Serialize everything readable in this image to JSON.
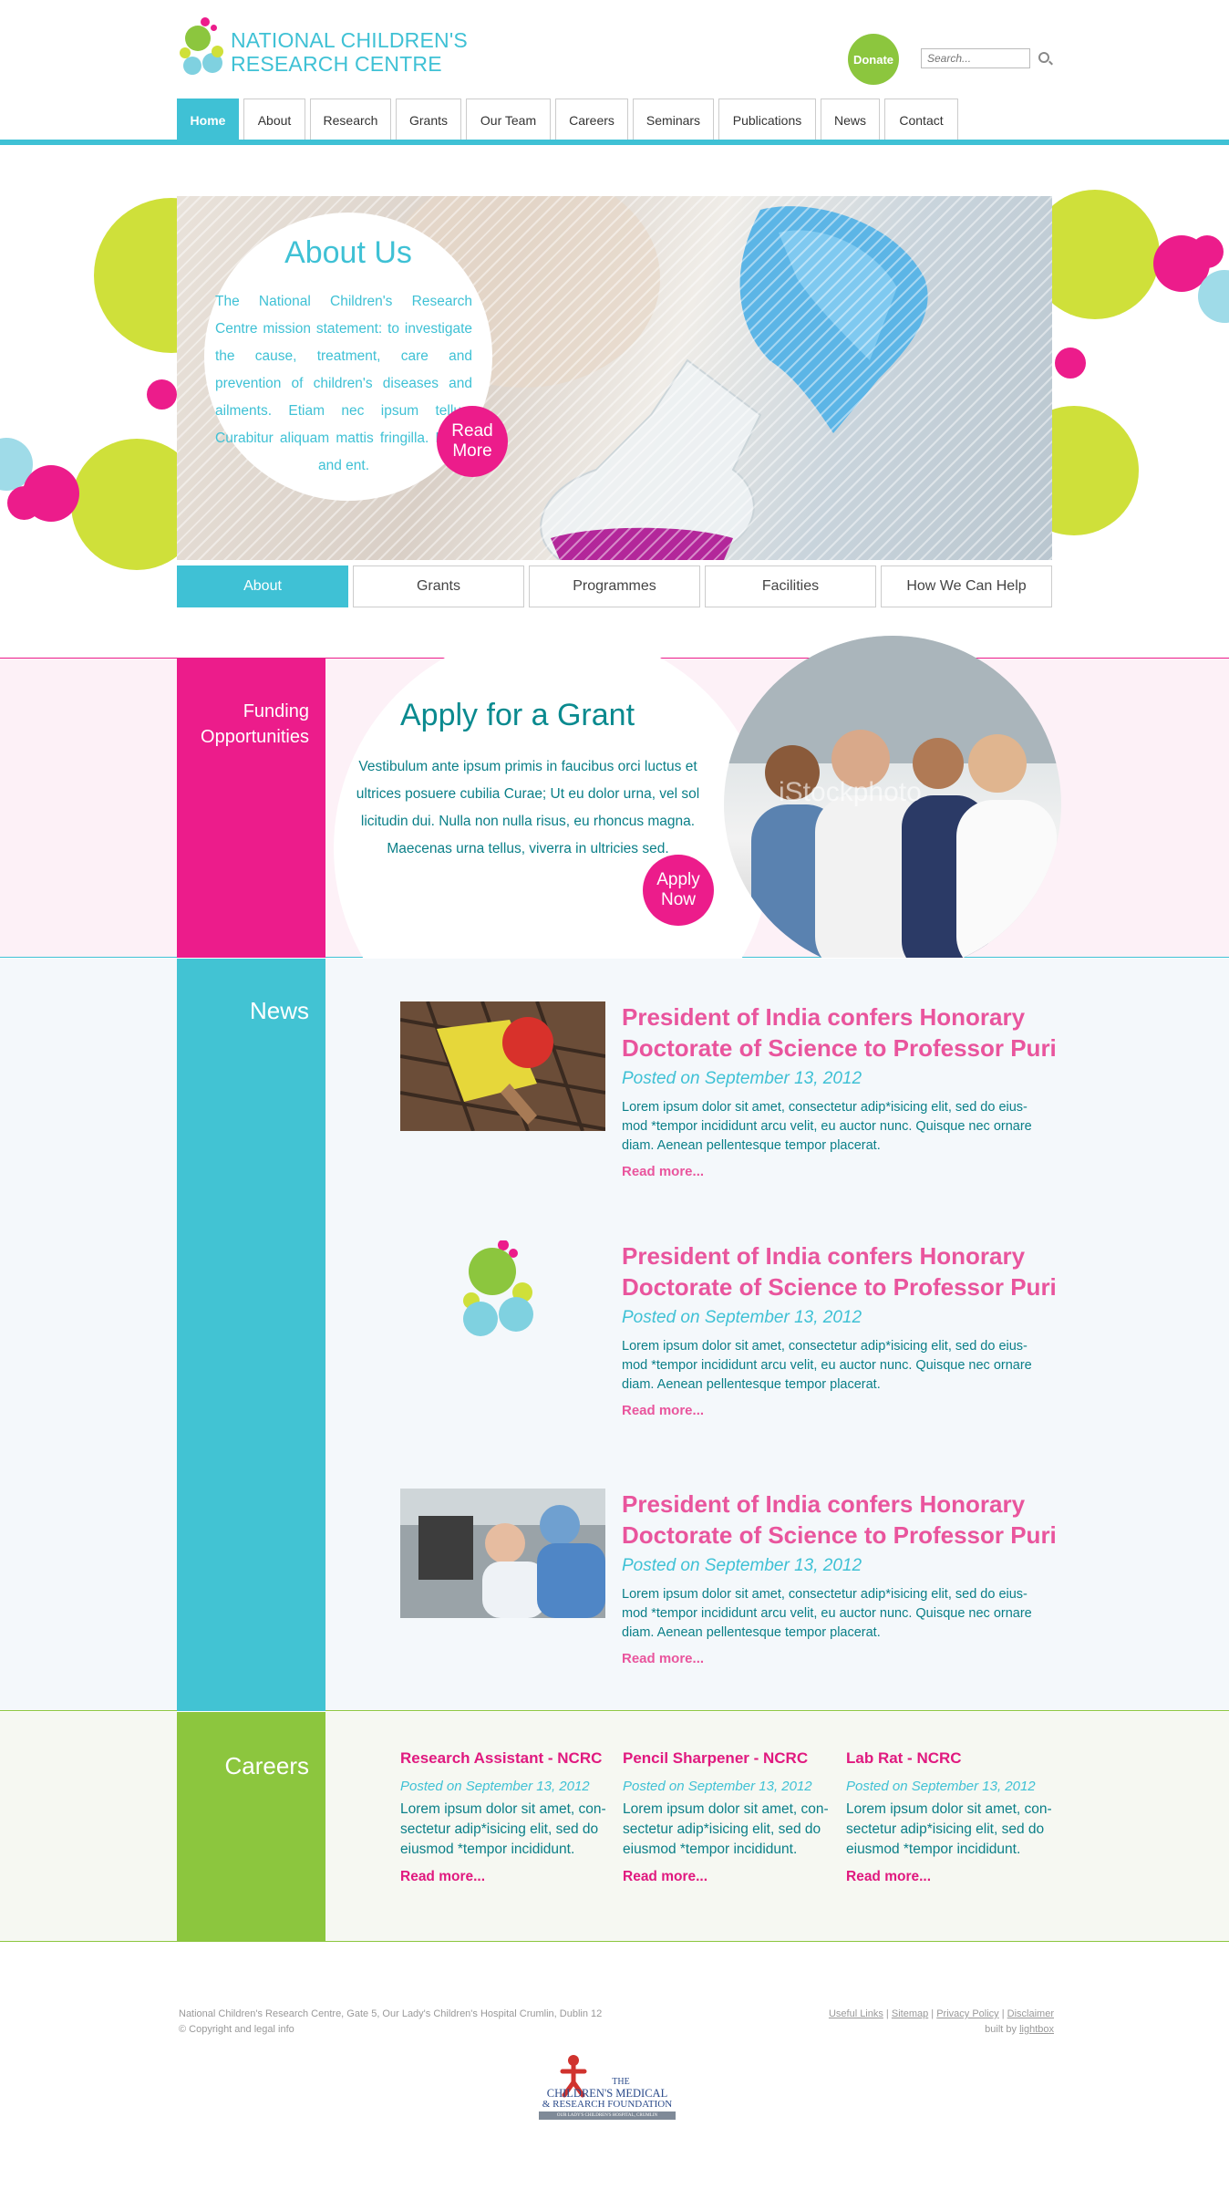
{
  "header": {
    "logo_line1": "NATIONAL CHILDREN'S",
    "logo_line2": "RESEARCH CENTRE",
    "donate_label": "Donate",
    "search_placeholder": "Search..."
  },
  "nav": {
    "items": [
      {
        "label": "Home",
        "active": true
      },
      {
        "label": "About"
      },
      {
        "label": "Research"
      },
      {
        "label": "Grants"
      },
      {
        "label": "Our Team"
      },
      {
        "label": "Careers"
      },
      {
        "label": "Seminars"
      },
      {
        "label": "Publications"
      },
      {
        "label": "News"
      },
      {
        "label": "Contact"
      }
    ]
  },
  "hero": {
    "title": "About Us",
    "text": "The National Children's Research Centre mission statement: to investigate the cause, treatment, care and prevention of children's diseases and ailments. Etiam nec ipsum tellus. Curabitur aliquam mattis fringilla. Praes and ent.",
    "button_line1": "Read",
    "button_line2": "More"
  },
  "subtabs": [
    {
      "label": "About",
      "active": true
    },
    {
      "label": "Grants"
    },
    {
      "label": "Programmes"
    },
    {
      "label": "Facilities"
    },
    {
      "label": "How We Can Help"
    }
  ],
  "funding": {
    "side_line1": "Funding",
    "side_line2": "Opportunities",
    "title": "Apply for a Grant",
    "text": "Vestibulum ante ipsum primis in faucibus orci luctus et ultrices posuere cubilia Curae; Ut eu dolor urna, vel sol licitudin dui. Nulla non nulla risus, eu rhoncus magna. Maecenas urna tellus, viverra in ultricies sed.",
    "button_line1": "Apply",
    "button_line2": "Now",
    "watermark": "iStockphoto"
  },
  "news": {
    "side_label": "News",
    "items": [
      {
        "title": "President of India confers Honorary Doctorate of Science to Professor Puri",
        "date": "Posted on September 13, 2012",
        "body": "Lorem ipsum dolor sit amet, consectetur adip*isicing elit, sed do eius-mod *tempor incididunt  arcu velit, eu auctor nunc. Quisque nec ornare diam. Aenean pellentesque tempor placerat.",
        "more": "Read more..."
      },
      {
        "title": "President of India confers Honorary Doctorate of Science to Professor Puri",
        "date": "Posted on September 13, 2012",
        "body": "Lorem ipsum dolor sit amet, consectetur adip*isicing elit, sed do eius-mod *tempor incididunt  arcu velit, eu auctor nunc. Quisque nec ornare diam. Aenean pellentesque tempor placerat.",
        "more": "Read more..."
      },
      {
        "title": "President of India confers Honorary Doctorate of Science to Professor Puri",
        "date": "Posted on September 13, 2012",
        "body": "Lorem ipsum dolor sit amet, consectetur adip*isicing elit, sed do eius-mod *tempor incididunt  arcu velit, eu auctor nunc. Quisque nec ornare diam. Aenean pellentesque tempor placerat.",
        "more": "Read more..."
      }
    ]
  },
  "careers": {
    "side_label": "Careers",
    "items": [
      {
        "title": "Research Assistant - NCRC",
        "date": "Posted on September 13, 2012",
        "body": "Lorem ipsum dolor sit amet, con-sectetur adip*isicing elit, sed do eiusmod *tempor incididunt.",
        "more": "Read more..."
      },
      {
        "title": "Pencil Sharpener - NCRC",
        "date": "Posted on September 13, 2012",
        "body": "Lorem ipsum dolor sit amet, con-sectetur adip*isicing elit, sed do eiusmod *tempor incididunt.",
        "more": "Read more..."
      },
      {
        "title": "Lab Rat - NCRC",
        "date": "Posted on September 13, 2012",
        "body": "Lorem ipsum dolor sit amet, con-sectetur adip*isicing elit, sed do eiusmod *tempor incididunt.",
        "more": "Read more..."
      }
    ]
  },
  "footer": {
    "address": "National Children's Research Centre, Gate 5, Our Lady's Children's Hospital Crumlin, Dublin 12",
    "copyright": "© Copyright and legal info",
    "links": [
      "Useful Links",
      "Sitemap",
      "Privacy Policy",
      "Disclaimer"
    ],
    "built_by_prefix": "built by",
    "built_by": "lightbox",
    "sponsor_line1": "THE",
    "sponsor_line2": "CHILDREN'S MEDICAL",
    "sponsor_line3": "& RESEARCH FOUNDATION",
    "sponsor_line4": "OUR LADY'S CHILDREN'S HOSPITAL, CRUMLIN"
  },
  "colors": {
    "teal": "#3fc1d5",
    "pink": "#ec1c8b",
    "green": "#8cc63e",
    "lime": "#cfe03a"
  }
}
